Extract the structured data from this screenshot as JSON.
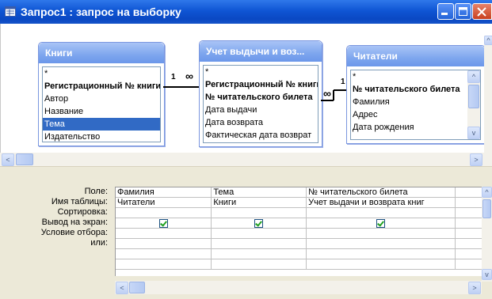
{
  "window": {
    "title": "Запрос1 : запрос на выборку",
    "icons": [
      "query-icon",
      "minimize-icon",
      "maximize-icon",
      "close-icon"
    ]
  },
  "tables": {
    "books": {
      "title": "Книги",
      "fields": [
        "*",
        "Регистрационный № книги",
        "Автор",
        "Название",
        "Тема",
        "Издательство"
      ]
    },
    "issues": {
      "title": "Учет выдычи и воз...",
      "fields": [
        "*",
        "Регистрационный № книги",
        "№ читательского билета",
        "Дата выдачи",
        "Дата возврата",
        "Фактическая дата возврат"
      ]
    },
    "readers": {
      "title": "Читатели",
      "fields": [
        "*",
        "№ читательского билета",
        "Фамилия",
        "Адрес",
        "Дата рождения"
      ]
    }
  },
  "relations": {
    "left": {
      "one": "1",
      "many": "∞"
    },
    "right": {
      "one": "1",
      "many": "∞"
    }
  },
  "grid": {
    "row_labels": [
      "Поле:",
      "Имя таблицы:",
      "Сортировка:",
      "Вывод на экран:",
      "Условие отбора:",
      "или:"
    ],
    "columns": [
      {
        "field": "Фамилия",
        "table": "Читатели",
        "sort": "",
        "show": true
      },
      {
        "field": "Тема",
        "table": "Книги",
        "sort": "",
        "show": true
      },
      {
        "field": "№ читательского билета",
        "table": "Учет выдачи и возврата книг",
        "sort": "",
        "show": true
      }
    ]
  },
  "scroll_arrows": {
    "left": "<",
    "right": ">",
    "up": "^",
    "down": "v"
  }
}
